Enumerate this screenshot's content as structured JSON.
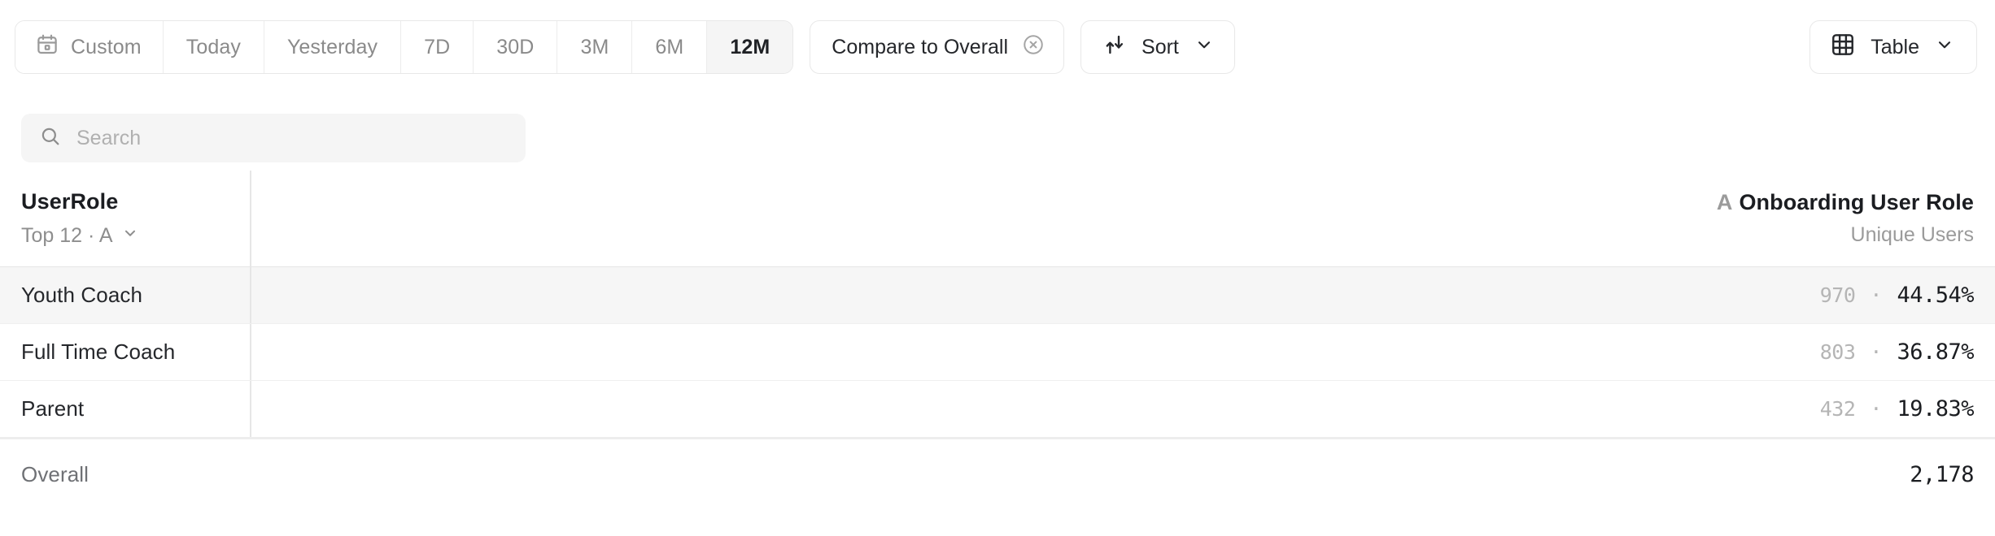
{
  "toolbar": {
    "date_segments": [
      {
        "label": "Custom",
        "icon": "calendar-icon",
        "active": false
      },
      {
        "label": "Today",
        "active": false
      },
      {
        "label": "Yesterday",
        "active": false
      },
      {
        "label": "7D",
        "active": false
      },
      {
        "label": "30D",
        "active": false
      },
      {
        "label": "3M",
        "active": false
      },
      {
        "label": "6M",
        "active": false
      },
      {
        "label": "12M",
        "active": true
      }
    ],
    "compare_label": "Compare to Overall",
    "compare_remove_icon": "circle-x-icon",
    "sort_label": "Sort",
    "sort_icon": "sort-arrows-icon",
    "sort_chevron_icon": "chevron-down-icon",
    "view_label": "Table",
    "view_icon": "grid-table-icon",
    "view_chevron_icon": "chevron-down-icon"
  },
  "search": {
    "placeholder": "Search",
    "value": "",
    "icon": "search-icon"
  },
  "table": {
    "dimension_header": "UserRole",
    "dimension_sub": "Top 12 · A",
    "dimension_sub_chevron": "chevron-down-icon",
    "metric_prefix": "A",
    "metric_header": "Onboarding User Role",
    "metric_sub": "Unique Users",
    "rows": [
      {
        "label": "Youth Coach",
        "count": "970",
        "sep": "·",
        "percent": "44.54%",
        "highlighted": true
      },
      {
        "label": "Full Time Coach",
        "count": "803",
        "sep": "·",
        "percent": "36.87%",
        "highlighted": false
      },
      {
        "label": "Parent",
        "count": "432",
        "sep": "·",
        "percent": "19.83%",
        "highlighted": false
      }
    ],
    "overall_label": "Overall",
    "overall_value": "2,178"
  },
  "chart_data": {
    "type": "table",
    "title": "Onboarding User Role",
    "xlabel": "UserRole",
    "ylabel": "Unique Users",
    "categories": [
      "Youth Coach",
      "Full Time Coach",
      "Parent"
    ],
    "values": [
      970,
      803,
      432
    ],
    "percents": [
      44.54,
      36.87,
      19.83
    ],
    "total": 2178,
    "total_label": "Overall",
    "date_range": "12M",
    "compare": "Compare to Overall",
    "grid": false,
    "legend": "none"
  },
  "colors": {
    "text_primary": "#1b1d21",
    "text_muted": "#8e8e8e",
    "row_highlight": "#f6f6f6",
    "border": "#e6e6e6",
    "surface": "#ffffff"
  }
}
